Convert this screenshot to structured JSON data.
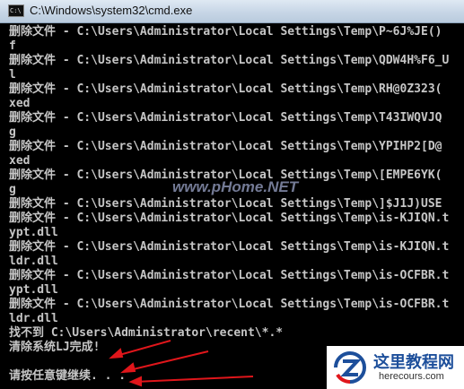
{
  "window": {
    "title": "C:\\Windows\\system32\\cmd.exe",
    "icon_text": "C:\\"
  },
  "console": {
    "lines": [
      "删除文件 - C:\\Users\\Administrator\\Local Settings\\Temp\\P~6J%JE()",
      "f",
      "删除文件 - C:\\Users\\Administrator\\Local Settings\\Temp\\QDW4H%F6_U",
      "l",
      "删除文件 - C:\\Users\\Administrator\\Local Settings\\Temp\\RH@0Z323(",
      "xed",
      "删除文件 - C:\\Users\\Administrator\\Local Settings\\Temp\\T43IWQVJQ",
      "g",
      "删除文件 - C:\\Users\\Administrator\\Local Settings\\Temp\\YPIHP2[D@",
      "xed",
      "删除文件 - C:\\Users\\Administrator\\Local Settings\\Temp\\[EMPE6YK(",
      "g",
      "删除文件 - C:\\Users\\Administrator\\Local Settings\\Temp\\]$J1J)USE",
      "删除文件 - C:\\Users\\Administrator\\Local Settings\\Temp\\is-KJIQN.t",
      "ypt.dll",
      "删除文件 - C:\\Users\\Administrator\\Local Settings\\Temp\\is-KJIQN.t",
      "ldr.dll",
      "删除文件 - C:\\Users\\Administrator\\Local Settings\\Temp\\is-OCFBR.t",
      "ypt.dll",
      "删除文件 - C:\\Users\\Administrator\\Local Settings\\Temp\\is-OCFBR.t",
      "ldr.dll",
      "找不到 C:\\Users\\Administrator\\recent\\*.*",
      "清除系统LJ完成!",
      "",
      "请按任意键继续. . ."
    ]
  },
  "watermark": {
    "text": "www.pHome.NET"
  },
  "logo": {
    "title": "这里教程网",
    "url": "herecours.com"
  },
  "annotation": {
    "arrow_color": "#e0161b"
  },
  "colors": {
    "console_bg": "#000000",
    "console_fg": "#c6c6c6",
    "titlebar": "#c7d6e6"
  }
}
